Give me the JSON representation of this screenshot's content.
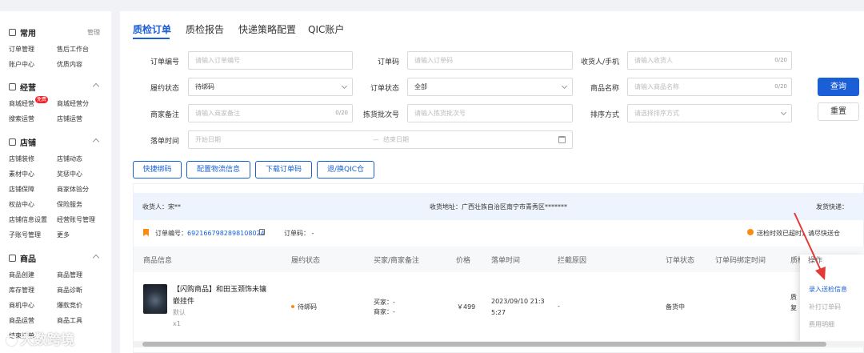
{
  "sidebar": {
    "common": {
      "title": "常用",
      "manage": "管理",
      "items": [
        "订单管理",
        "售后工作台",
        "账户中心",
        "优质内容"
      ]
    },
    "ops": {
      "title": "经营",
      "items": [
        "商城经营",
        "商城经营分",
        "搜索运营",
        "店铺运营"
      ],
      "badge": "免费"
    },
    "shop": {
      "title": "店铺",
      "items": [
        "店铺装修",
        "店铺动态",
        "素材中心",
        "奖惩中心",
        "店铺保障",
        "商家体验分",
        "权益中心",
        "保险服务",
        "店铺信息设置",
        "经营账号管理",
        "子账号管理",
        "更多"
      ]
    },
    "goods": {
      "title": "商品",
      "items": [
        "商品创建",
        "商品管理",
        "库存管理",
        "商品诊断",
        "商机中心",
        "爆款竞价",
        "商品运营",
        "商品工具",
        "结束订单"
      ]
    }
  },
  "tabs": [
    "质检订单",
    "质检报告",
    "快递策略配置",
    "QIC账户"
  ],
  "filters": {
    "order_no": {
      "label": "订单编号",
      "placeholder": "请输入订单编号"
    },
    "order_code": {
      "label": "订单码",
      "placeholder": "请输入订单码"
    },
    "receiver": {
      "label": "收货人/手机",
      "placeholder": "请输入收货人",
      "count": "0/20"
    },
    "fulfil": {
      "label": "履约状态",
      "value": "待绑码"
    },
    "order_status": {
      "label": "订单状态",
      "value": "全部"
    },
    "goods_name": {
      "label": "商品名称",
      "placeholder": "请输入商品名称",
      "count": "0/20"
    },
    "merchant_note": {
      "label": "商家备注",
      "placeholder": "请输入商家备注",
      "count": "0/20"
    },
    "batch": {
      "label": "拣货批次号",
      "placeholder": "请输入拣货批次号"
    },
    "sort": {
      "label": "排序方式",
      "placeholder": "请选择排序方式"
    },
    "order_time": {
      "label": "落单时间",
      "start": "开始日期",
      "sep": "—",
      "end": "结束日期"
    }
  },
  "buttons": {
    "query": "查询",
    "reset": "重置",
    "quick_bind": "快捷绑码",
    "config_logistics": "配置物流信息",
    "download_code": "下载订单码",
    "return_qic": "退/换QIC仓"
  },
  "order": {
    "receiver": "收货人：宋**",
    "address": "收货地址：广西壮族自治区南宁市青秀区*******",
    "ship": "发货快递：",
    "order_no_label": "订单编号：",
    "order_no": "6921667982898108024",
    "order_code_label": "订单码：",
    "order_code": "-",
    "warning": "送检时效已超时，请尽快送仓"
  },
  "table": {
    "headers": [
      "商品信息",
      "履约状态",
      "买家/商家备注",
      "价格",
      "落单时间",
      "拦截原因",
      "订单状态",
      "订单码绑定时间",
      "质检",
      "操作"
    ],
    "row": {
      "title_line1": "【闪购商品】和田玉颈饰未镶",
      "title_line2": "嵌挂件",
      "spec": "默认",
      "qty": "x1",
      "fulfil": "待绑码",
      "buyer": "买家：-",
      "merchant": "商家：-",
      "price": "￥499",
      "time1": "2023/09/10 21:3",
      "time2": "5:27",
      "intercept": "-",
      "status": "备货中",
      "qc1": "质",
      "qc2": "复"
    }
  },
  "actions": {
    "enter_info": "录入送检信息",
    "reprint": "补打订单码",
    "fee": "费用明细"
  },
  "watermark": "大数跨境",
  "colors": {
    "primary": "#1a5fd6",
    "warning": "#fa8c16",
    "arrow": "#e53935"
  }
}
